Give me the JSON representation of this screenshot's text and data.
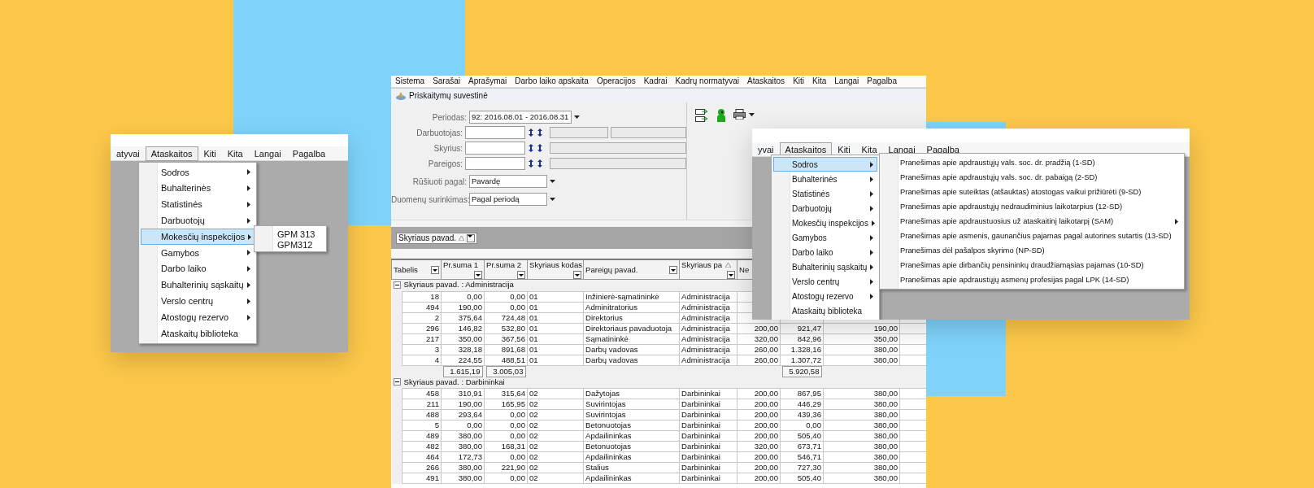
{
  "left_panel": {
    "menu_bar": [
      {
        "label": "atyvai",
        "selected": false
      },
      {
        "label": "Ataskaitos",
        "selected": true
      },
      {
        "label": "Kiti",
        "selected": false
      },
      {
        "label": "Kita",
        "selected": false
      },
      {
        "label": "Langai",
        "selected": false
      },
      {
        "label": "Pagalba",
        "selected": false
      }
    ],
    "menu": [
      {
        "label": "Sodros",
        "submenu": true,
        "selected": false
      },
      {
        "label": "Buhalterinės",
        "submenu": true,
        "selected": false
      },
      {
        "label": "Statistinės",
        "submenu": true,
        "selected": false
      },
      {
        "label": "Darbuotojų",
        "submenu": true,
        "selected": false
      },
      {
        "label": "Mokesčių inspekcijos",
        "submenu": true,
        "selected": true
      },
      {
        "label": "Gamybos",
        "submenu": true,
        "selected": false
      },
      {
        "label": "Darbo laiko",
        "submenu": true,
        "selected": false
      },
      {
        "label": "Buhalterinių sąskaitų",
        "submenu": true,
        "selected": false
      },
      {
        "label": "Verslo centrų",
        "submenu": true,
        "selected": false
      },
      {
        "label": "Atostogų rezervo",
        "submenu": true,
        "selected": false
      },
      {
        "label": "Ataskaitų biblioteka",
        "submenu": false,
        "selected": false
      }
    ],
    "submenu": [
      "GPM 313",
      "GPM312"
    ]
  },
  "main_window": {
    "menu_bar": [
      "Sistema",
      "Sarašai",
      "Aprašymai",
      "Darbo laiko apskaita",
      "Operacijos",
      "Kadrai",
      "Kadrų normatyvai",
      "Ataskaitos",
      "Kiti",
      "Kita",
      "Langai",
      "Pagalba"
    ],
    "title": "Priskaitymų suvestinė",
    "form": [
      {
        "label": "Periodas:",
        "kind": "select",
        "value": "92: 2016.08.01 - 2016.08.31"
      },
      {
        "label": "Darbuotojas:",
        "kind": "lookup_split"
      },
      {
        "label": "Skyrius:",
        "kind": "lookup"
      },
      {
        "label": "Pareigos:",
        "kind": "lookup"
      },
      {
        "label": "Rūšiuoti pagal:",
        "kind": "select",
        "value": "Pavardę"
      },
      {
        "label": "Duomenų surinkimas:",
        "kind": "select",
        "value": "Pagal periodą"
      }
    ],
    "group_by": "Skyriaus pavad.",
    "columns": [
      "Tabelis",
      "Pr.suma 1",
      "Pr.suma 2",
      "Skyriaus kodas",
      "Pareigų pavad.",
      "Skyriaus pa",
      "Ne"
    ],
    "groups": [
      {
        "label": "Skyriaus pavad. : Administracija",
        "rows": [
          [
            "18",
            "0,00",
            "0,00",
            "01",
            "Inžinierė-sąmatininkė",
            "Administracija",
            null,
            null,
            null
          ],
          [
            "494",
            "190,00",
            "0,00",
            "01",
            "Adminitratorius",
            "Administracija",
            null,
            null,
            null
          ],
          [
            "2",
            "375,64",
            "724,48",
            "01",
            "Direktorius",
            "Administracija",
            null,
            null,
            null
          ],
          [
            "296",
            "146,82",
            "532,80",
            "01",
            "Direktoriaus pavaduotoja",
            "Administracija",
            "200,00",
            "921,47",
            "190,00"
          ],
          [
            "217",
            "350,00",
            "367,56",
            "01",
            "Sąmatininkė",
            "Administracija",
            "320,00",
            "842,96",
            "350,00"
          ],
          [
            "3",
            "328,18",
            "891,68",
            "01",
            "Darbų vadovas",
            "Administracija",
            "260,00",
            "1.328,16",
            "380,00"
          ],
          [
            "4",
            "224,55",
            "488,51",
            "01",
            "Darbų vadovas",
            "Administracija",
            "260,00",
            "1.307,72",
            "380,00"
          ]
        ],
        "totals": {
          "column_2": "1.615,19",
          "column_3": "3.005,03",
          "column_8": "5.920,58"
        }
      },
      {
        "label": "Skyriaus pavad. : Darbininkai",
        "rows": [
          [
            "458",
            "310,91",
            "315,64",
            "02",
            "Dažytojas",
            "Darbininkai",
            "200,00",
            "867,95",
            "380,00"
          ],
          [
            "211",
            "190,00",
            "165,95",
            "02",
            "Suvirintojas",
            "Darbininkai",
            "200,00",
            "446,29",
            "380,00"
          ],
          [
            "488",
            "293,64",
            "0,00",
            "02",
            "Suvirintojas",
            "Darbininkai",
            "200,00",
            "439,36",
            "380,00"
          ],
          [
            "5",
            "0,00",
            "0,00",
            "02",
            "Betonuotojas",
            "Darbininkai",
            "200,00",
            "0,00",
            "380,00"
          ],
          [
            "489",
            "380,00",
            "0,00",
            "02",
            "Apdailininkas",
            "Darbininkai",
            "200,00",
            "505,40",
            "380,00"
          ],
          [
            "482",
            "380,00",
            "168,31",
            "02",
            "Betonuotojas",
            "Darbininkai",
            "320,00",
            "673,71",
            "380,00"
          ],
          [
            "464",
            "172,73",
            "0,00",
            "02",
            "Apdailininkas",
            "Darbininkai",
            "200,00",
            "546,71",
            "380,00"
          ],
          [
            "266",
            "380,00",
            "221,90",
            "02",
            "Stalius",
            "Darbininkai",
            "200,00",
            "727,30",
            "380,00"
          ],
          [
            "491",
            "380,00",
            "0,00",
            "02",
            "Apdailininkas",
            "Darbininkai",
            "200,00",
            "505,40",
            "380,00"
          ]
        ]
      }
    ]
  },
  "right_panel": {
    "menu_bar": [
      {
        "label": "yvai",
        "selected": false
      },
      {
        "label": "Ataskaitos",
        "selected": true
      },
      {
        "label": "Kiti",
        "selected": false
      },
      {
        "label": "Kita",
        "selected": false
      },
      {
        "label": "Langai",
        "selected": false
      },
      {
        "label": "Pagalba",
        "selected": false
      }
    ],
    "menu": [
      {
        "label": "Sodros",
        "submenu": true,
        "selected": true
      },
      {
        "label": "Buhalterinės",
        "submenu": true,
        "selected": false
      },
      {
        "label": "Statistinės",
        "submenu": true,
        "selected": false
      },
      {
        "label": "Darbuotojų",
        "submenu": true,
        "selected": false
      },
      {
        "label": "Mokesčių inspekcijos",
        "submenu": true,
        "selected": false
      },
      {
        "label": "Gamybos",
        "submenu": true,
        "selected": false
      },
      {
        "label": "Darbo laiko",
        "submenu": true,
        "selected": false
      },
      {
        "label": "Buhalterinių sąskaitų",
        "submenu": true,
        "selected": false
      },
      {
        "label": "Verslo centrų",
        "submenu": true,
        "selected": false
      },
      {
        "label": "Atostogų rezervo",
        "submenu": true,
        "selected": false
      },
      {
        "label": "Ataskaitų biblioteka",
        "submenu": false,
        "selected": false
      }
    ],
    "submenu": [
      {
        "label": "Pranešimas apie apdraustųjų vals. soc. dr. pradžią (1-SD)",
        "submenu": false
      },
      {
        "label": "Pranešimas apie apdraustųjų vals. soc. dr. pabaigą (2-SD)",
        "submenu": false
      },
      {
        "label": "Pranešimas apie suteiktas (atšauktas) atostogas vaikui prižiūrėti (9-SD)",
        "submenu": false
      },
      {
        "label": "Pranešimas apie apdraustųjų nedraudiminius laikotarpius (12-SD)",
        "submenu": false
      },
      {
        "label": "Pranešimas apie apdraustuosius už ataskaitinį laikotarpį (SAM)",
        "submenu": true
      },
      {
        "label": "Pranešimas apie asmenis, gaunančius pajamas pagal autorines sutartis (13-SD)",
        "submenu": false
      },
      {
        "label": "Pranešimas dėl pašalpos skyrimo (NP-SD)",
        "submenu": false
      },
      {
        "label": "Pranešimas apie dirbančių pensininkų draudžiamąsias pajamas (10-SD)",
        "submenu": false
      },
      {
        "label": "Pranešimas apie apdraustųjų asmenų profesijas pagal LPK (14-SD)",
        "submenu": false
      }
    ]
  }
}
